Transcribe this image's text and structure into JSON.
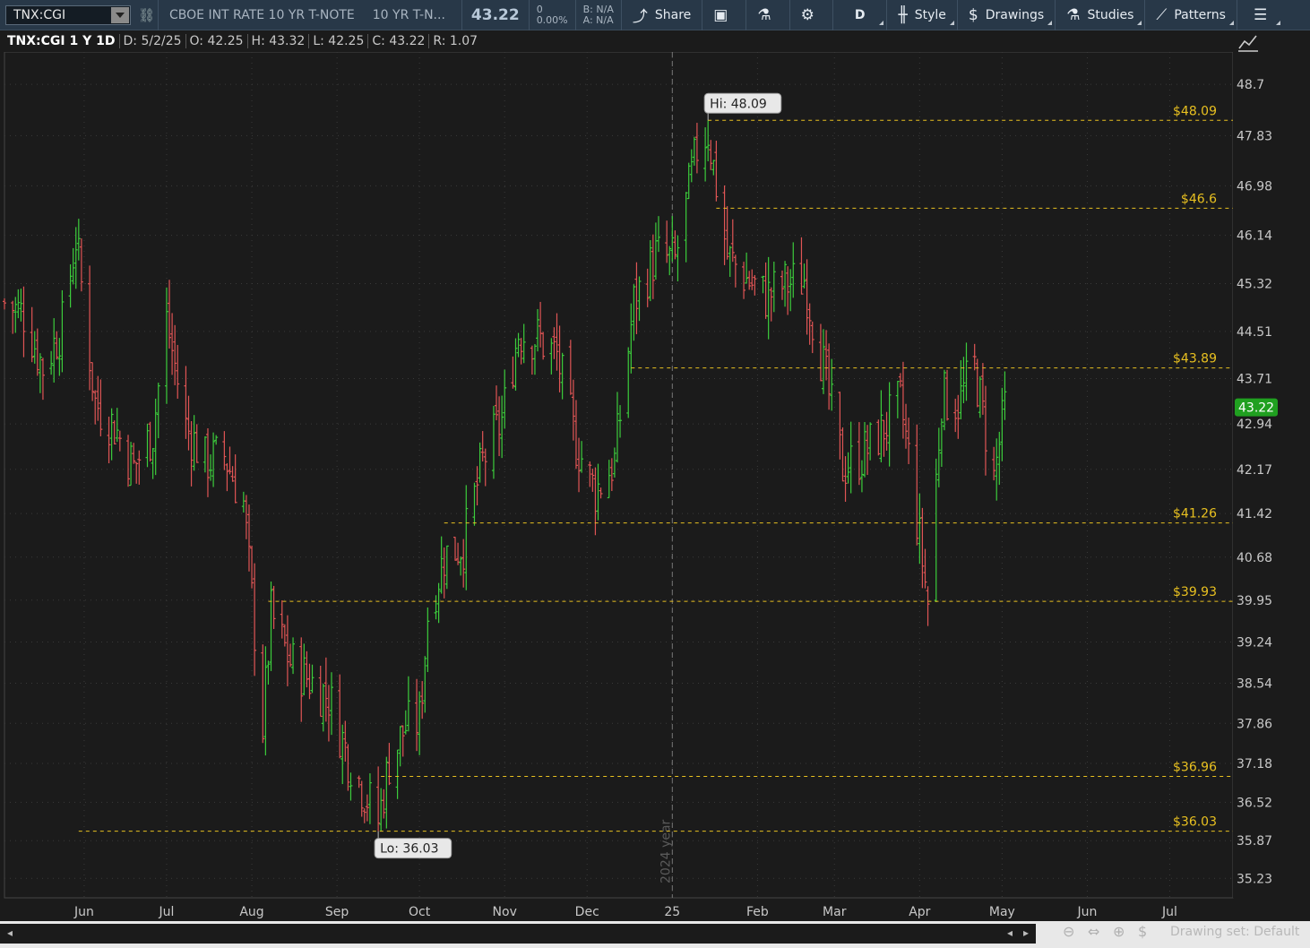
{
  "toolbar": {
    "symbol": "TNX:CGI",
    "description": "CBOE INT RATE 10 YR T-NOTE",
    "description_short": "10 YR T-N...",
    "last_price": "43.22",
    "change": "0",
    "change_pct": "0.00%",
    "bid": "B: N/A",
    "ask": "A: N/A",
    "share_label": "Share",
    "period_label": "D",
    "style_label": "Style",
    "drawings_label": "Drawings",
    "studies_label": "Studies",
    "patterns_label": "Patterns",
    "icons": [
      "link-icon",
      "share-icon",
      "calendar-icon",
      "flask-icon",
      "gear-icon",
      "candle-icon",
      "dollar-icon",
      "flask-icon",
      "patterns-icon",
      "menu-icon"
    ]
  },
  "header": {
    "ticker": "TNX:CGI 1 Y 1D",
    "date": "D: 5/2/25",
    "open": "O: 42.25",
    "high": "H: 43.32",
    "low": "L: 42.25",
    "close": "C: 43.22",
    "range": "R: 1.07"
  },
  "footer": {
    "drawing_set": "Drawing set: Default"
  },
  "chart_data": {
    "type": "bar",
    "subtype": "ohlc",
    "title": "",
    "xlabel": "",
    "ylabel": "",
    "ylim": [
      34.9,
      49.25
    ],
    "y_ticks": [
      "48.7",
      "47.83",
      "46.98",
      "46.14",
      "45.32",
      "44.51",
      "43.71",
      "42.94",
      "42.17",
      "41.42",
      "40.68",
      "39.95",
      "39.24",
      "38.54",
      "37.86",
      "37.18",
      "36.52",
      "35.87",
      "35.23"
    ],
    "x_ticks": [
      {
        "label": "Jun",
        "date": "2024-06-01"
      },
      {
        "label": "Jul",
        "date": "2024-07-01"
      },
      {
        "label": "Aug",
        "date": "2024-08-01"
      },
      {
        "label": "Sep",
        "date": "2024-09-01"
      },
      {
        "label": "Oct",
        "date": "2024-10-01"
      },
      {
        "label": "Nov",
        "date": "2024-11-01"
      },
      {
        "label": "Dec",
        "date": "2024-12-01"
      },
      {
        "label": "25",
        "date": "2025-01-01"
      },
      {
        "label": "Feb",
        "date": "2025-02-01"
      },
      {
        "label": "Mar",
        "date": "2025-03-01"
      },
      {
        "label": "Apr",
        "date": "2025-04-01"
      },
      {
        "label": "May",
        "date": "2025-05-01"
      },
      {
        "label": "Jun",
        "date": "2025-06-01"
      },
      {
        "label": "Jul",
        "date": "2025-07-01"
      }
    ],
    "x_range": [
      "2024-05-03",
      "2025-07-24"
    ],
    "year_divider": {
      "date": "2025-01-01",
      "label": "2024 year"
    },
    "grid": true,
    "last_price_tag": "43.22",
    "high_label": "Hi: 48.09",
    "low_label": "Lo: 36.03",
    "high": {
      "value": 48.09,
      "date": "2025-01-14"
    },
    "low": {
      "value": 36.03,
      "date": "2024-09-16"
    },
    "levels": [
      {
        "value": 48.09,
        "label": "$48.09",
        "from": "2025-01-14"
      },
      {
        "value": 46.6,
        "label": "$46.6",
        "from": "2025-01-17"
      },
      {
        "value": 43.89,
        "label": "$43.89",
        "from": "2024-12-17"
      },
      {
        "value": 41.26,
        "label": "$41.26",
        "from": "2024-10-10"
      },
      {
        "value": 39.93,
        "label": "$39.93",
        "from": "2024-08-07"
      },
      {
        "value": 36.96,
        "label": "$36.96",
        "from": "2024-09-17"
      },
      {
        "value": 36.03,
        "label": "$36.03",
        "from": "2024-05-30"
      }
    ],
    "up_color": "#3ccc3c",
    "down_color": "#e05555",
    "level_color": "#e8c020",
    "series": [
      {
        "date": "2024-05-03",
        "close": 45.0
      },
      {
        "date": "2024-05-10",
        "close": 44.8
      },
      {
        "date": "2024-05-17",
        "close": 43.9
      },
      {
        "date": "2024-05-24",
        "close": 44.6
      },
      {
        "date": "2024-05-29",
        "close": 46.1
      },
      {
        "date": "2024-06-05",
        "close": 43.3
      },
      {
        "date": "2024-06-12",
        "close": 42.9
      },
      {
        "date": "2024-06-19",
        "close": 42.2
      },
      {
        "date": "2024-06-26",
        "close": 42.8
      },
      {
        "date": "2024-07-01",
        "close": 44.7
      },
      {
        "date": "2024-07-08",
        "close": 42.9
      },
      {
        "date": "2024-07-15",
        "close": 42.3
      },
      {
        "date": "2024-07-22",
        "close": 42.4
      },
      {
        "date": "2024-07-29",
        "close": 41.6
      },
      {
        "date": "2024-08-05",
        "close": 37.8
      },
      {
        "date": "2024-08-08",
        "close": 39.7
      },
      {
        "date": "2024-08-15",
        "close": 38.9
      },
      {
        "date": "2024-08-22",
        "close": 38.6
      },
      {
        "date": "2024-08-29",
        "close": 38.3
      },
      {
        "date": "2024-09-05",
        "close": 37.3
      },
      {
        "date": "2024-09-12",
        "close": 36.6
      },
      {
        "date": "2024-09-16",
        "close": 36.2
      },
      {
        "date": "2024-09-20",
        "close": 37.2
      },
      {
        "date": "2024-09-26",
        "close": 37.8
      },
      {
        "date": "2024-10-01",
        "close": 37.9
      },
      {
        "date": "2024-10-04",
        "close": 39.7
      },
      {
        "date": "2024-10-10",
        "close": 40.7
      },
      {
        "date": "2024-10-17",
        "close": 40.9
      },
      {
        "date": "2024-10-24",
        "close": 42.3
      },
      {
        "date": "2024-10-31",
        "close": 43.0
      },
      {
        "date": "2024-11-06",
        "close": 44.5
      },
      {
        "date": "2024-11-13",
        "close": 44.4
      },
      {
        "date": "2024-11-20",
        "close": 44.1
      },
      {
        "date": "2024-11-27",
        "close": 42.6
      },
      {
        "date": "2024-12-04",
        "close": 41.8
      },
      {
        "date": "2024-12-11",
        "close": 42.3
      },
      {
        "date": "2024-12-18",
        "close": 45.0
      },
      {
        "date": "2024-12-26",
        "close": 45.8
      },
      {
        "date": "2025-01-02",
        "close": 45.7
      },
      {
        "date": "2025-01-10",
        "close": 47.6
      },
      {
        "date": "2025-01-14",
        "close": 47.9
      },
      {
        "date": "2025-01-21",
        "close": 45.8
      },
      {
        "date": "2025-01-28",
        "close": 45.4
      },
      {
        "date": "2025-02-04",
        "close": 45.1
      },
      {
        "date": "2025-02-11",
        "close": 45.3
      },
      {
        "date": "2025-02-18",
        "close": 45.4
      },
      {
        "date": "2025-02-25",
        "close": 43.9
      },
      {
        "date": "2025-03-04",
        "close": 42.2
      },
      {
        "date": "2025-03-11",
        "close": 42.4
      },
      {
        "date": "2025-03-18",
        "close": 42.8
      },
      {
        "date": "2025-03-25",
        "close": 43.3
      },
      {
        "date": "2025-03-28",
        "close": 42.4
      },
      {
        "date": "2025-04-04",
        "close": 39.9
      },
      {
        "date": "2025-04-09",
        "close": 43.4
      },
      {
        "date": "2025-04-15",
        "close": 43.3
      },
      {
        "date": "2025-04-21",
        "close": 43.9
      },
      {
        "date": "2025-04-28",
        "close": 42.0
      },
      {
        "date": "2025-05-02",
        "close": 43.22
      }
    ]
  }
}
